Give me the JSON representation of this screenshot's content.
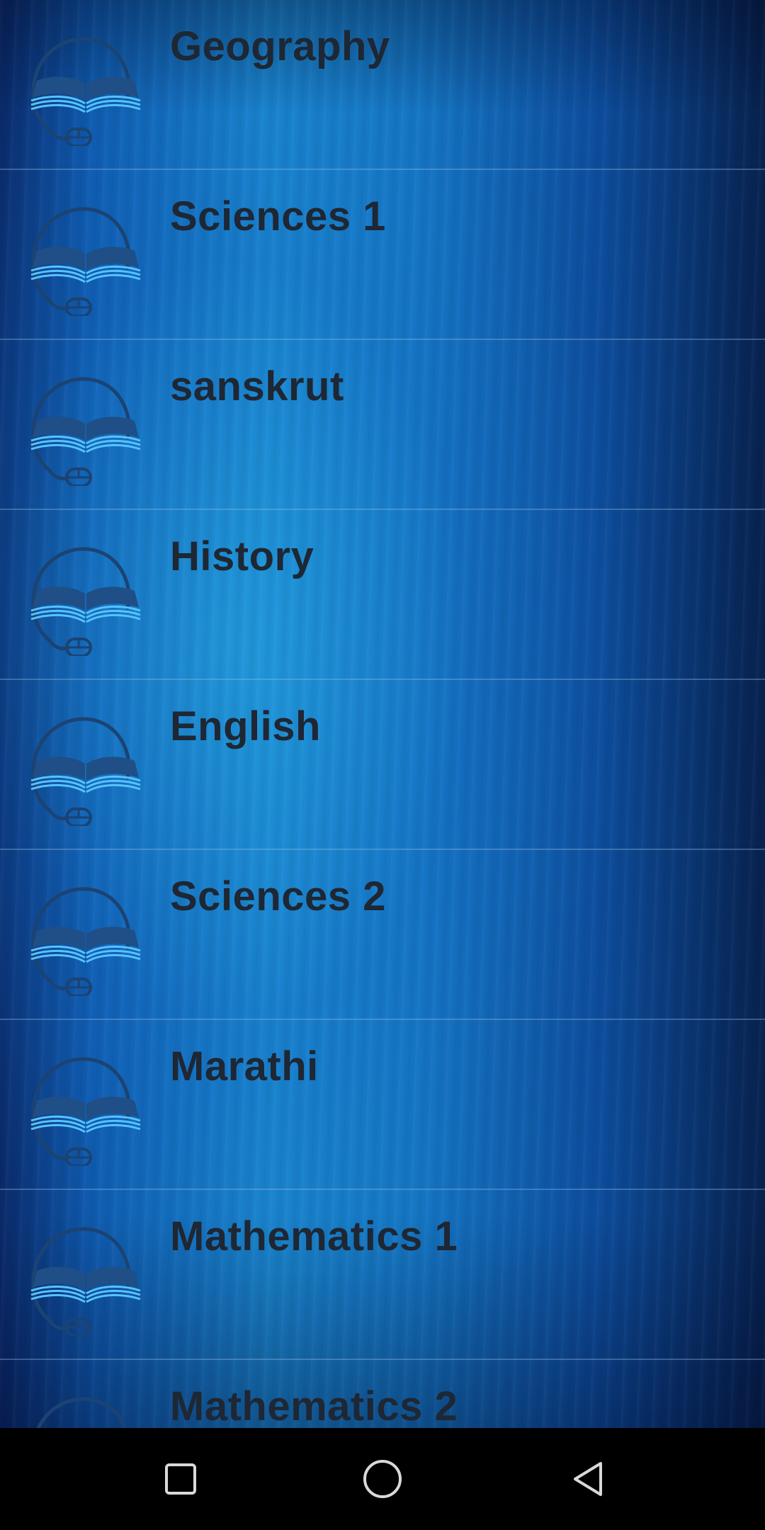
{
  "subjects": [
    {
      "label": "Geography",
      "icon": "book-mouse-icon"
    },
    {
      "label": "Sciences 1",
      "icon": "book-mouse-icon"
    },
    {
      "label": "sanskrut",
      "icon": "book-mouse-icon"
    },
    {
      "label": "History",
      "icon": "book-mouse-icon"
    },
    {
      "label": "English",
      "icon": "book-mouse-icon"
    },
    {
      "label": "Sciences 2",
      "icon": "book-mouse-icon"
    },
    {
      "label": "Marathi",
      "icon": "book-mouse-icon"
    },
    {
      "label": "Mathematics 1",
      "icon": "book-mouse-icon"
    },
    {
      "label": "Mathematics 2",
      "icon": "book-mouse-icon"
    }
  ],
  "navbar": {
    "recents": "recents-square-icon",
    "home": "home-circle-icon",
    "back": "back-triangle-icon"
  },
  "colors": {
    "label": "#1e2733",
    "icon_book": "#1f4f86",
    "icon_pages": "#56c3ff",
    "icon_outline": "#1b4373",
    "navbar_bg": "#000000",
    "nav_icon": "#d9d9d9"
  }
}
